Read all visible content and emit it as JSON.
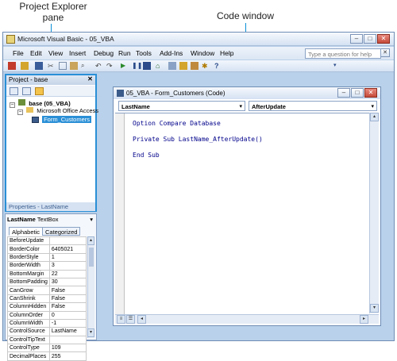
{
  "callouts": {
    "project_explorer": "Project Explorer\npane",
    "code_window": "Code window"
  },
  "app": {
    "title": "Microsoft Visual Basic - 05_VBA",
    "menu": [
      "File",
      "Edit",
      "View",
      "Insert",
      "Debug",
      "Run",
      "Tools",
      "Add-Ins",
      "Window",
      "Help"
    ],
    "help_placeholder": "Type a question for help"
  },
  "project": {
    "title": "Project - base",
    "root": "base (05_VBA)",
    "folder": "Microsoft Office Access",
    "item": "Form_Customers",
    "status": "Properties - LastName"
  },
  "properties": {
    "object_name": "LastName",
    "object_type": "TextBox",
    "tabs": [
      "Alphabetic",
      "Categorized"
    ],
    "rows": [
      [
        "BeforeUpdate",
        ""
      ],
      [
        "BorderColor",
        "6405021"
      ],
      [
        "BorderStyle",
        "1"
      ],
      [
        "BorderWidth",
        "3"
      ],
      [
        "BottomMargin",
        "22"
      ],
      [
        "BottomPadding",
        "30"
      ],
      [
        "CanGrow",
        "False"
      ],
      [
        "CanShrink",
        "False"
      ],
      [
        "ColumnHidden",
        "False"
      ],
      [
        "ColumnOrder",
        "0"
      ],
      [
        "ColumnWidth",
        "-1"
      ],
      [
        "ControlSource",
        "LastName"
      ],
      [
        "ControlTipText",
        ""
      ],
      [
        "ControlType",
        "109"
      ],
      [
        "DecimalPlaces",
        "255"
      ]
    ]
  },
  "code": {
    "title": "05_VBA - Form_Customers (Code)",
    "object_combo": "LastName",
    "proc_combo": "AfterUpdate",
    "lines": [
      "Option Compare Database",
      "Private Sub LastName_AfterUpdate()",
      "End Sub"
    ]
  },
  "colors": {
    "accent": "#2a8fd6",
    "keyword": "#00008b",
    "chrome": "#b9d1ea"
  }
}
